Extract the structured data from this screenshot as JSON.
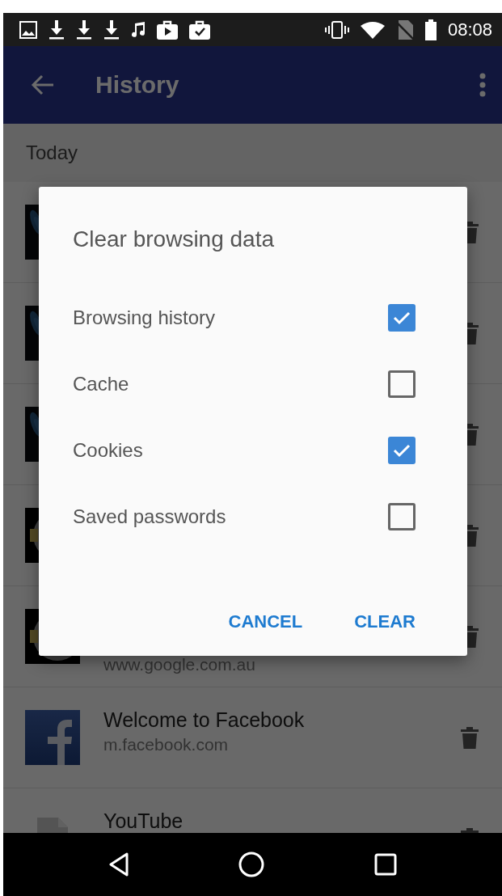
{
  "status_bar": {
    "time": "08:08"
  },
  "app_bar": {
    "title": "History"
  },
  "section": "Today",
  "history": [
    {
      "kind": "wing"
    },
    {
      "kind": "wing"
    },
    {
      "kind": "wing"
    },
    {
      "kind": "circle"
    },
    {
      "kind": "circle",
      "url": "www.google.com.au"
    },
    {
      "kind": "facebook",
      "title": "Welcome to Facebook",
      "url": "m.facebook.com"
    },
    {
      "kind": "document",
      "title": "YouTube"
    }
  ],
  "dialog": {
    "title": "Clear browsing data",
    "options": [
      {
        "label": "Browsing history",
        "checked": true
      },
      {
        "label": "Cache",
        "checked": false
      },
      {
        "label": "Cookies",
        "checked": true
      },
      {
        "label": "Saved passwords",
        "checked": false
      }
    ],
    "buttons": [
      "CANCEL",
      "CLEAR"
    ]
  }
}
